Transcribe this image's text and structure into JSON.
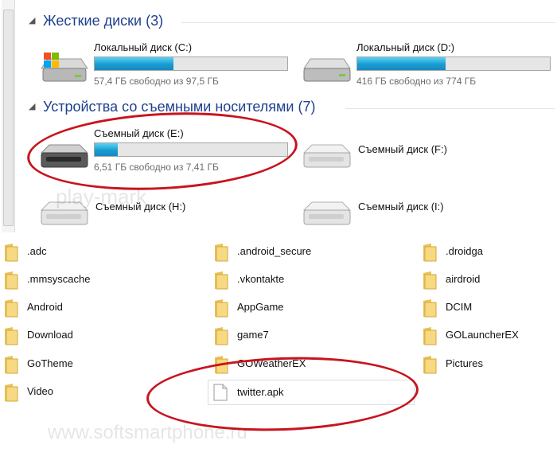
{
  "groups": {
    "hard_disks": {
      "label": "Жесткие диски (3)"
    },
    "removable": {
      "label": "Устройства со съемными носителями (7)"
    }
  },
  "drives": [
    {
      "name": "Локальный диск (C:)",
      "info": "57,4 ГБ свободно из 97,5 ГБ",
      "used_fraction": 0.41,
      "icon": "windows-drive-icon"
    },
    {
      "name": "Локальный диск (D:)",
      "info": "416 ГБ свободно из 774 ГБ",
      "used_fraction": 0.46,
      "icon": "hard-drive-icon"
    },
    {
      "name": "Съемный диск (E:)",
      "info": "6,51 ГБ свободно из 7,41 ГБ",
      "used_fraction": 0.12,
      "icon": "removable-drive-icon"
    },
    {
      "name": "Съемный диск (F:)",
      "icon": "removable-drive-icon"
    },
    {
      "name": "Съемный диск (H:)",
      "icon": "removable-drive-icon"
    },
    {
      "name": "Съемный диск (I:)",
      "icon": "removable-drive-icon"
    }
  ],
  "files": [
    {
      "name": ".adc",
      "type": "folder"
    },
    {
      "name": ".android_secure",
      "type": "folder"
    },
    {
      "name": ".droidga",
      "type": "folder"
    },
    {
      "name": ".mmsyscache",
      "type": "folder"
    },
    {
      "name": ".vkontakte",
      "type": "folder"
    },
    {
      "name": "airdroid",
      "type": "folder"
    },
    {
      "name": "Android",
      "type": "folder"
    },
    {
      "name": "AppGame",
      "type": "folder"
    },
    {
      "name": "DCIM",
      "type": "folder"
    },
    {
      "name": "Download",
      "type": "folder"
    },
    {
      "name": "game7",
      "type": "folder"
    },
    {
      "name": "GOLauncherEX",
      "type": "folder"
    },
    {
      "name": "GoTheme",
      "type": "folder"
    },
    {
      "name": "GOWeatherEX",
      "type": "folder"
    },
    {
      "name": "Pictures",
      "type": "folder"
    },
    {
      "name": "Video",
      "type": "folder"
    },
    {
      "name": "twitter.apk",
      "type": "file"
    }
  ],
  "watermark": {
    "top": "play-mark",
    "bottom": "www.softsmartphone.ru"
  },
  "colors": {
    "accent": "#1f3f8f",
    "highlight": "#c8141e",
    "bar": "#1a9cd3"
  }
}
